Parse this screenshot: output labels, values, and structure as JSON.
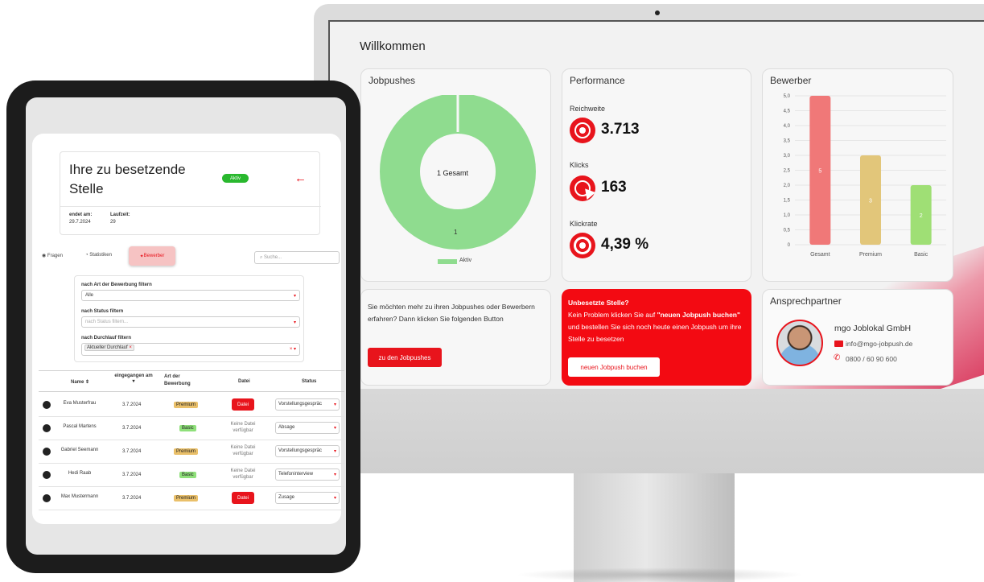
{
  "dashboard": {
    "welcome": "Willkommen",
    "jobpushes": {
      "title": "Jobpushes",
      "center": "1 Gesamt",
      "segment_value": "1",
      "legend": "Aktiv"
    },
    "performance": {
      "title": "Performance",
      "reach_label": "Reichweite",
      "reach_value": "3.713",
      "clicks_label": "Klicks",
      "clicks_value": "163",
      "rate_label": "Klickrate",
      "rate_value": "4,39 %"
    },
    "applicants": {
      "title": "Bewerber"
    },
    "info_text": "Sie möchten mehr zu ihren Jobpushes oder Bewerbern erfahren? Dann klicken Sie folgenden Button",
    "info_button": "zu den Jobpushes",
    "promo": {
      "title": "Unbesetzte Stelle?",
      "text_1": "Kein Problem klicken Sie auf ",
      "text_bold": "\"neuen Jobpush buchen\"",
      "text_2": " und bestellen Sie sich noch heute einen Jobpush um ihre Stelle zu besetzen",
      "button": "neuen Jobpush buchen"
    },
    "contact": {
      "title": "Ansprechpartner",
      "company": "mgo Joblokal GmbH",
      "email": "info@mgo-jobpush.de",
      "phone": "0800 / 60 90 600"
    },
    "colors": {
      "accent": "#e8141c",
      "green": "#8fdc8f",
      "bar_gesamt": "#f07878",
      "bar_premium": "#e2c67a",
      "bar_basic": "#9fdf75"
    }
  },
  "chart_data": {
    "type": "bar",
    "categories": [
      "Gesamt",
      "Premium",
      "Basic"
    ],
    "values": [
      5,
      3,
      2
    ],
    "ylim": [
      0,
      5
    ],
    "yticks": [
      "0",
      "0,5",
      "1,0",
      "1,5",
      "2,0",
      "2,5",
      "3,0",
      "3,5",
      "4,0",
      "4,5",
      "5,0"
    ],
    "title": "",
    "xlabel": "",
    "ylabel": ""
  },
  "tablet": {
    "title_line1": "Ihre zu besetzende",
    "title_line2": "Stelle",
    "status_badge": "Aktiv",
    "ends_label": "endet am:",
    "ends_value": "29.7.2024",
    "runtime_label": "Laufzeit:",
    "runtime_value": "29",
    "tabs": [
      "Fragen",
      "Statistiken",
      "Bewerber"
    ],
    "search_placeholder": "Suche...",
    "filter_type_label": "nach Art der Bewerbung filtern",
    "filter_type_value": "Alle",
    "filter_status_label": "nach Status filtern",
    "filter_status_placeholder": "nach Status filtern...",
    "filter_run_label": "nach Durchlauf filtern",
    "filter_run_chip": "Aktueller Durchlauf",
    "columns": [
      "Name ⇕",
      "eingegangen am",
      "Art der Bewerbung",
      "Datei",
      "Status"
    ],
    "rows": [
      {
        "name": "Eva Musterfrau",
        "date": "3.7.2024",
        "type": "Premium",
        "file": "Datei",
        "status": "Vorstellungsgespräc"
      },
      {
        "name": "Pascal Martens",
        "date": "3.7.2024",
        "type": "Basic",
        "file": "Keine Datei verfügbar",
        "status": "Absage"
      },
      {
        "name": "Gabriel Seemann",
        "date": "3.7.2024",
        "type": "Premium",
        "file": "Keine Datei verfügbar",
        "status": "Vorstellungsgespräc"
      },
      {
        "name": "Hedi Raab",
        "date": "3.7.2024",
        "type": "Basic",
        "file": "Keine Datei verfügbar",
        "status": "Telefoninterview"
      },
      {
        "name": "Max Mustermann",
        "date": "3.7.2024",
        "type": "Premium",
        "file": "Datei",
        "status": "Zusage"
      }
    ]
  }
}
